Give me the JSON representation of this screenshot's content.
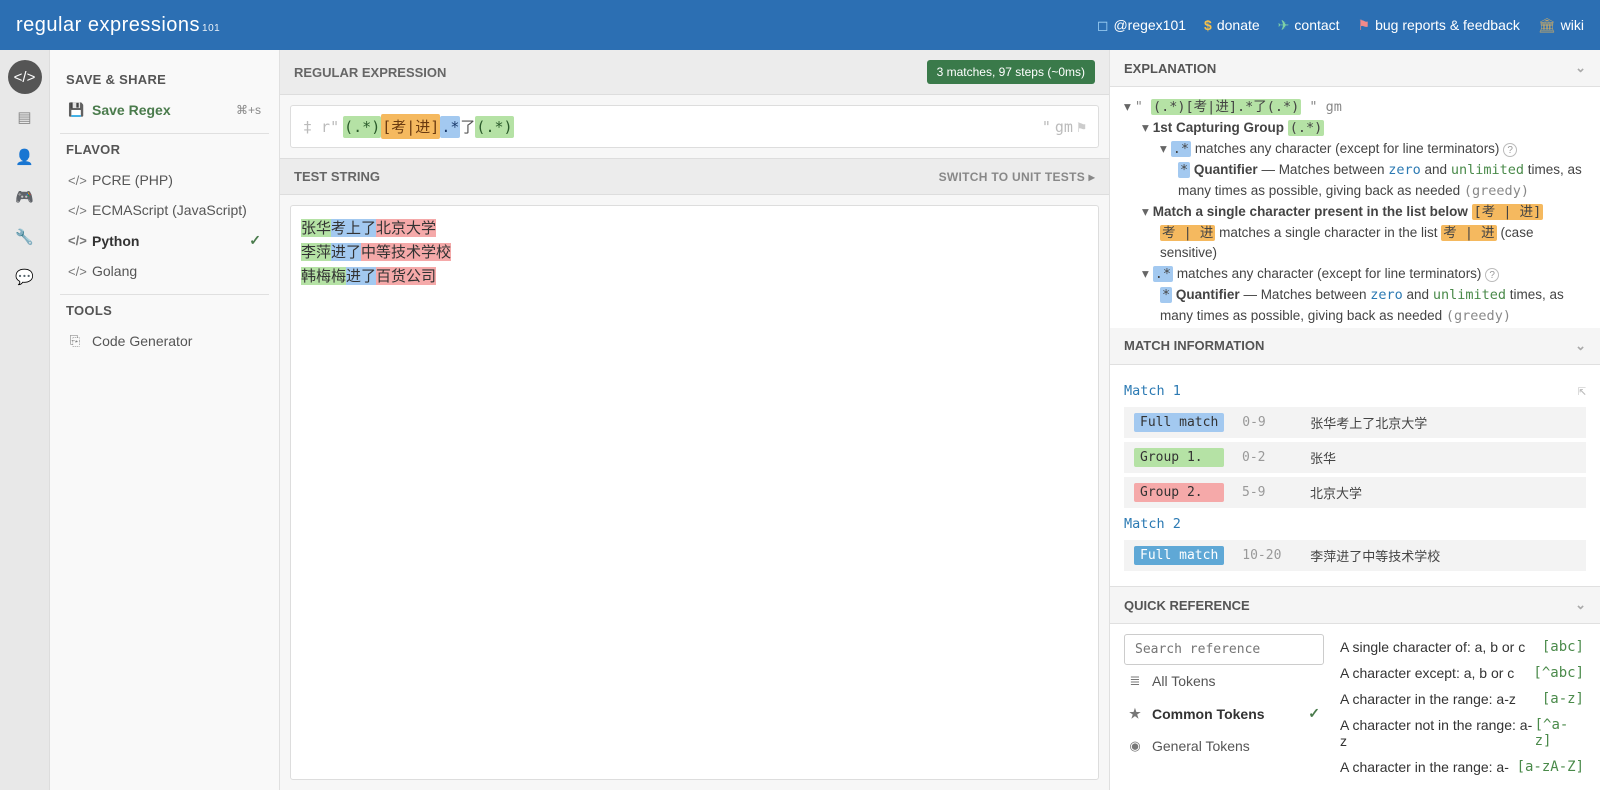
{
  "header": {
    "logo_reg": "regular",
    "logo_exp": " expressions",
    "logo_sub": "101",
    "links": {
      "user": "@regex101",
      "donate": "donate",
      "contact": "contact",
      "bugs": "bug reports & feedback",
      "wiki": "wiki"
    }
  },
  "left": {
    "save_share": "SAVE & SHARE",
    "save_regex": "Save Regex",
    "save_key": "⌘+s",
    "flavor": "FLAVOR",
    "flavors": {
      "pcre": "PCRE (PHP)",
      "ecma": "ECMAScript (JavaScript)",
      "python": "Python",
      "golang": "Golang"
    },
    "tools": "TOOLS",
    "code_gen": "Code Generator"
  },
  "center": {
    "regex_label": "REGULAR EXPRESSION",
    "badge": "3 matches, 97 steps (~0ms)",
    "delim_l": "‡ r\"",
    "delim_r": "\"",
    "flags": "gm",
    "pattern": {
      "g1": "(.*)",
      "cls": "[考|进]",
      "q1": ".*",
      "lit": "了",
      "g2": "(.*)"
    },
    "test_label": "TEST STRING",
    "switch": "SWITCH TO UNIT TESTS  ▸",
    "lines": [
      {
        "g1": "张华",
        "mid": "考上了",
        "g2": "北京大学"
      },
      {
        "g1": "李萍",
        "mid": "进了",
        "g2": "中等技术学校"
      },
      {
        "g1": "韩梅梅",
        "mid": "进了",
        "g2": "百货公司"
      }
    ]
  },
  "explain": {
    "title": "EXPLANATION",
    "full_pat": "(.*)[考|进].*了(.*)",
    "flags_txt": "gm",
    "grp1": "1st Capturing Group",
    "grp1_code": "(.*)",
    "any_desc": "matches any character (except for line terminators)",
    "quant_label": "Quantifier",
    "quant_desc_a": "— Matches between ",
    "zero": "zero",
    "and": " and ",
    "unlimited": "unlimited",
    "quant_desc_b": " times, as many times as possible, giving back as needed",
    "greedy": "(greedy)",
    "cls_head": "Match a single character present in the list below",
    "cls_code": "[考 | 进]",
    "cls_body_a": "考 | 进",
    "cls_body_b": "matches a single character in the list",
    "cls_body_c": "(case sensitive)",
    "quant_tail": "times, as many times as possible, giving back as needed"
  },
  "matchinfo": {
    "title": "MATCH INFORMATION",
    "m1": "Match 1",
    "m2": "Match 2",
    "rows1": [
      {
        "tag": "Full match",
        "cls": "tag-full",
        "range": "0-9",
        "val": "张华考上了北京大学"
      },
      {
        "tag": "Group 1.",
        "cls": "tag-g1",
        "range": "0-2",
        "val": "张华"
      },
      {
        "tag": "Group 2.",
        "cls": "tag-g2",
        "range": "5-9",
        "val": "北京大学"
      }
    ],
    "rows2": [
      {
        "tag": "Full match",
        "cls": "tag-full2",
        "range": "10-20",
        "val": "李萍进了中等技术学校"
      }
    ]
  },
  "quickref": {
    "title": "QUICK REFERENCE",
    "search_ph": "Search reference",
    "cats": {
      "all": "All Tokens",
      "common": "Common Tokens",
      "general": "General Tokens"
    },
    "items": [
      {
        "desc": "A single character of: a, b or c",
        "patt": "[abc]"
      },
      {
        "desc": "A character except: a, b or c",
        "patt": "[^abc]"
      },
      {
        "desc": "A character in the range: a-z",
        "patt": "[a-z]"
      },
      {
        "desc": "A character not in the range: a-z",
        "patt": "[^a-z]"
      },
      {
        "desc": "A character in the range: a-",
        "patt": "[a-zA-Z]"
      }
    ]
  }
}
